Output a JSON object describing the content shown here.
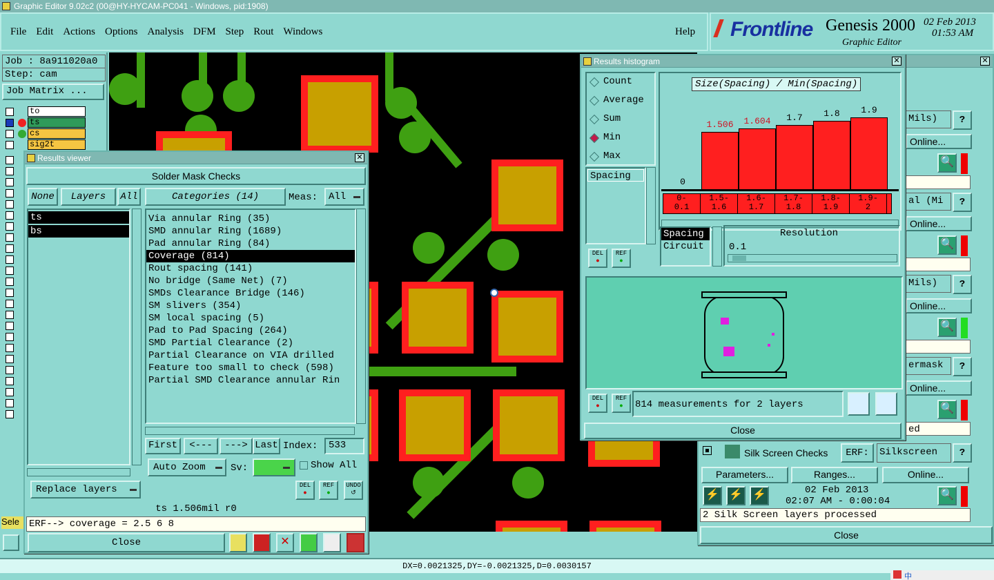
{
  "app": {
    "title": "Graphic Editor 9.02c2 (00@HY-HYCAM-PC041 - Windows, pid:1908)"
  },
  "menu": {
    "items": [
      "File",
      "Edit",
      "Actions",
      "Options",
      "Analysis",
      "DFM",
      "Step",
      "Rout",
      "Windows"
    ],
    "help": "Help"
  },
  "brand": {
    "logo": "Frontline",
    "product": "Genesis 2000",
    "subtitle": "Graphic Editor",
    "date": "02 Feb 2013",
    "time": "01:53 AM"
  },
  "job": {
    "job": "Job : 8a911020a0",
    "step": "Step: cam",
    "matrix": "Job Matrix ..."
  },
  "layers": [
    {
      "name": "to",
      "color": "#ffffff"
    },
    {
      "name": "ts",
      "color": "#2f9a5a"
    },
    {
      "name": "cs",
      "color": "#f5c542"
    },
    {
      "name": "sig2t",
      "color": "#f5c542"
    }
  ],
  "results_viewer": {
    "title": "Results viewer",
    "header": "Solder Mask Checks",
    "none": "None",
    "layers_btn": "Layers",
    "all": "All",
    "layers": [
      "ts",
      "bs"
    ],
    "categories_btn": "Categories (14)",
    "meas_label": "Meas:",
    "meas_value": "All",
    "categories": [
      "Via annular Ring (35)",
      "SMD annular Ring (1689)",
      "Pad annular Ring (84)",
      "Coverage (814)",
      "Rout spacing (141)",
      "No bridge (Same Net) (7)",
      "SMDs Clearance Bridge (146)",
      "SM slivers (354)",
      "SM local spacing (5)",
      "Pad to Pad Spacing (264)",
      "SMD Partial Clearance (2)",
      "Partial Clearance on VIA drilled",
      "Feature too small to check (598)",
      "Partial SMD Clearance annular Rin"
    ],
    "selected_category": 3,
    "nav": {
      "first": "First",
      "prev": "<---",
      "next": "--->",
      "last": "Last",
      "index_label": "Index:",
      "index_value": "533"
    },
    "auto_zoom": "Auto Zoom",
    "sv_label": "Sv:",
    "show_all": "Show All",
    "replace_layers": "Replace layers",
    "del": "DEL",
    "ref": "REF",
    "undo": "UNDO",
    "status": "ts 1.506mil  r0",
    "erf": "ERF--> coverage = 2.5 6 8",
    "close": "Close"
  },
  "histogram": {
    "title": "Results histogram",
    "radios": [
      "Count",
      "Average",
      "Sum",
      "Min",
      "Max"
    ],
    "selected_radio": "Min",
    "measure_list": [
      "Spacing"
    ],
    "chart_title": "Size(Spacing) / Min(Spacing)",
    "chart_data": {
      "type": "bar",
      "categories": [
        "0-0.1",
        "1.5-1.6",
        "1.6-1.7",
        "1.7-1.8",
        "1.8-1.9",
        "1.9-2"
      ],
      "values": [
        0,
        1.506,
        1.604,
        1.7,
        1.8,
        1.9
      ],
      "value_labels": [
        "0",
        "1.506",
        "1.604",
        "1.7",
        "1.8",
        "1.9"
      ],
      "title": "Size(Spacing) / Min(Spacing)"
    },
    "cat_labels": [
      [
        "0-",
        "0.1"
      ],
      [
        "1.5-",
        "1.6"
      ],
      [
        "1.6-",
        "1.7"
      ],
      [
        "1.7-",
        "1.8"
      ],
      [
        "1.8-",
        "1.9"
      ],
      [
        "1.9-",
        "2"
      ]
    ],
    "types": [
      "Spacing",
      "Circuit"
    ],
    "resolution_label": "Resolution",
    "resolution_value": "0.1",
    "summary": "814 measurements for 2 layers",
    "close": "Close",
    "del": "DEL",
    "ref": "REF"
  },
  "checks": {
    "rows": [
      {
        "field": "Mils)",
        "btn": "Online...",
        "led": "red"
      },
      {
        "field": "al (Mi",
        "btn": "Online...",
        "led": "red"
      },
      {
        "field": "Mils)",
        "btn": "Online...",
        "led": "green"
      },
      {
        "field": "ermask",
        "btn": "Online...",
        "led": "red"
      }
    ],
    "row_tail": "ed",
    "silk": {
      "name": "Silk Screen Checks",
      "erf_label": "ERF:",
      "erf_value": "Silkscreen",
      "params": "Parameters...",
      "ranges": "Ranges...",
      "online": "Online...",
      "date": "02 Feb 2013",
      "time": "02:07 AM - 0:00:04",
      "status": "2 Silk Screen layers processed"
    },
    "close": "Close",
    "help": "?"
  },
  "statusbar": {
    "coords": "DX=0.0021325,DY=-0.0021325,D=0.0030157",
    "sel": "Sele"
  },
  "tray": {
    "ime": "中"
  }
}
